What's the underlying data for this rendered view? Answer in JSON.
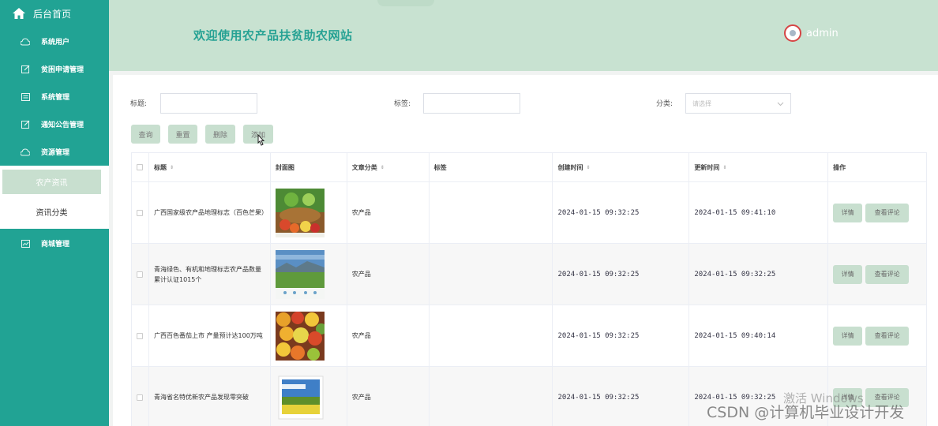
{
  "sidebar": {
    "home_label": "后台首页",
    "items": [
      {
        "label": "系统用户",
        "icon": "cloud-icon"
      },
      {
        "label": "贫困申请管理",
        "icon": "edit-icon"
      },
      {
        "label": "系统管理",
        "icon": "list-icon"
      },
      {
        "label": "通知公告管理",
        "icon": "edit-icon"
      },
      {
        "label": "资源管理",
        "icon": "cloud-icon"
      }
    ],
    "sub_items": [
      {
        "label": "农产资讯",
        "active": true
      },
      {
        "label": "资讯分类",
        "active": false
      }
    ],
    "bottom_item": {
      "label": "商城管理",
      "icon": "chart-icon"
    }
  },
  "header": {
    "title": "欢迎使用农产品扶贫助农网站",
    "user": "admin"
  },
  "search": {
    "title_label": "标题:",
    "tag_label": "标签:",
    "category_label": "分类:",
    "category_placeholder": "请选择"
  },
  "actions": {
    "query": "查询",
    "reset": "重置",
    "delete": "删除",
    "add": "添加"
  },
  "table": {
    "headers": {
      "title": "标题",
      "cover": "封面图",
      "category": "文章分类",
      "tags": "标签",
      "created": "创建时间",
      "updated": "更新时间",
      "ops": "操作"
    },
    "rows": [
      {
        "title": "广西国家级农产品地理标志（百色芒果）",
        "category": "农产品",
        "tags": "",
        "created": "2024-01-15 09:32:25",
        "updated": "2024-01-15 09:41:10"
      },
      {
        "title": "青海绿色、有机和地理标志农产品数量累计认证1015个",
        "category": "农产品",
        "tags": "",
        "created": "2024-01-15 09:32:25",
        "updated": "2024-01-15 09:32:25"
      },
      {
        "title": "广西百色番茄上市 产量预计达100万吨",
        "category": "农产品",
        "tags": "",
        "created": "2024-01-15 09:32:25",
        "updated": "2024-01-15 09:40:14"
      },
      {
        "title": "青海省名特优新农产品发现零突破",
        "category": "农产品",
        "tags": "",
        "created": "2024-01-15 09:32:25",
        "updated": "2024-01-15 09:32:25"
      }
    ],
    "op_detail": "详情",
    "op_comment": "查看评论"
  },
  "overlay": {
    "activation": "激活 Windows",
    "csdn": "CSDN @计算机毕业设计开发"
  },
  "colors": {
    "sidebar": "#21a394",
    "header": "#c8e2d1",
    "accent": "#27a294",
    "button": "#c8dfcf"
  }
}
